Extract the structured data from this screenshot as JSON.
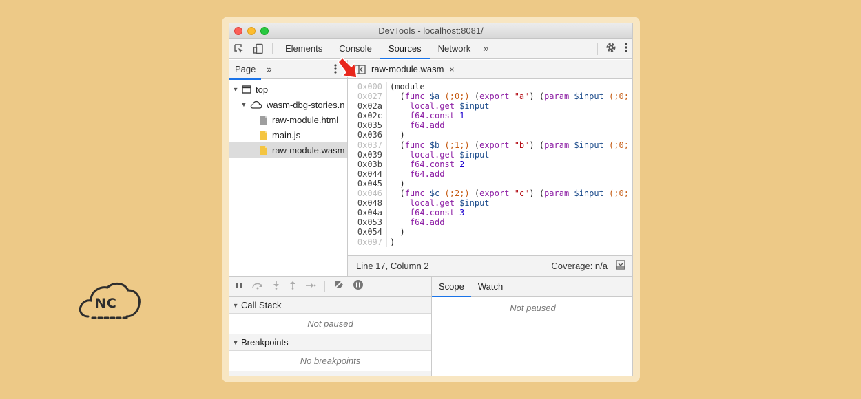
{
  "window": {
    "title": "DevTools - localhost:8081/"
  },
  "main_tabs": [
    {
      "label": "Elements"
    },
    {
      "label": "Console"
    },
    {
      "label": "Sources"
    },
    {
      "label": "Network"
    }
  ],
  "main_tabs_more": "»",
  "navigator": {
    "tab": "Page",
    "more": "»",
    "tree": [
      {
        "label": "top"
      },
      {
        "label": "wasm-dbg-stories.n"
      },
      {
        "label": "raw-module.html"
      },
      {
        "label": "main.js"
      },
      {
        "label": "raw-module.wasm"
      }
    ]
  },
  "editor": {
    "tab_label": "raw-module.wasm",
    "close": "×",
    "lines": [
      {
        "addr": "0x000",
        "parts": [
          [
            "p",
            "(module"
          ]
        ]
      },
      {
        "addr": "0x027",
        "parts": [
          [
            "p",
            "  ("
          ],
          [
            "kw",
            "func"
          ],
          [
            "p",
            " "
          ],
          [
            "var",
            "$a"
          ],
          [
            "p",
            " "
          ],
          [
            "cmt",
            "(;0;)"
          ],
          [
            "p",
            " ("
          ],
          [
            "kw",
            "export"
          ],
          [
            "p",
            " "
          ],
          [
            "str",
            "\"a\""
          ],
          [
            "p",
            ") ("
          ],
          [
            "kw",
            "param"
          ],
          [
            "p",
            " "
          ],
          [
            "var",
            "$input"
          ],
          [
            "p",
            " "
          ],
          [
            "cmt",
            "(;0;"
          ]
        ]
      },
      {
        "addr": "0x02a",
        "parts": [
          [
            "p",
            "    "
          ],
          [
            "kw",
            "local.get"
          ],
          [
            "p",
            " "
          ],
          [
            "var",
            "$input"
          ]
        ]
      },
      {
        "addr": "0x02c",
        "parts": [
          [
            "p",
            "    "
          ],
          [
            "kw",
            "f64.const"
          ],
          [
            "p",
            " "
          ],
          [
            "num",
            "1"
          ]
        ]
      },
      {
        "addr": "0x035",
        "parts": [
          [
            "p",
            "    "
          ],
          [
            "kw",
            "f64.add"
          ]
        ]
      },
      {
        "addr": "0x036",
        "parts": [
          [
            "p",
            "  )"
          ]
        ]
      },
      {
        "addr": "0x037",
        "parts": [
          [
            "p",
            "  ("
          ],
          [
            "kw",
            "func"
          ],
          [
            "p",
            " "
          ],
          [
            "var",
            "$b"
          ],
          [
            "p",
            " "
          ],
          [
            "cmt",
            "(;1;)"
          ],
          [
            "p",
            " ("
          ],
          [
            "kw",
            "export"
          ],
          [
            "p",
            " "
          ],
          [
            "str",
            "\"b\""
          ],
          [
            "p",
            ") ("
          ],
          [
            "kw",
            "param"
          ],
          [
            "p",
            " "
          ],
          [
            "var",
            "$input"
          ],
          [
            "p",
            " "
          ],
          [
            "cmt",
            "(;0;"
          ]
        ]
      },
      {
        "addr": "0x039",
        "parts": [
          [
            "p",
            "    "
          ],
          [
            "kw",
            "local.get"
          ],
          [
            "p",
            " "
          ],
          [
            "var",
            "$input"
          ]
        ]
      },
      {
        "addr": "0x03b",
        "parts": [
          [
            "p",
            "    "
          ],
          [
            "kw",
            "f64.const"
          ],
          [
            "p",
            " "
          ],
          [
            "num",
            "2"
          ]
        ]
      },
      {
        "addr": "0x044",
        "parts": [
          [
            "p",
            "    "
          ],
          [
            "kw",
            "f64.add"
          ]
        ]
      },
      {
        "addr": "0x045",
        "parts": [
          [
            "p",
            "  )"
          ]
        ]
      },
      {
        "addr": "0x046",
        "parts": [
          [
            "p",
            "  ("
          ],
          [
            "kw",
            "func"
          ],
          [
            "p",
            " "
          ],
          [
            "var",
            "$c"
          ],
          [
            "p",
            " "
          ],
          [
            "cmt",
            "(;2;)"
          ],
          [
            "p",
            " ("
          ],
          [
            "kw",
            "export"
          ],
          [
            "p",
            " "
          ],
          [
            "str",
            "\"c\""
          ],
          [
            "p",
            ") ("
          ],
          [
            "kw",
            "param"
          ],
          [
            "p",
            " "
          ],
          [
            "var",
            "$input"
          ],
          [
            "p",
            " "
          ],
          [
            "cmt",
            "(;0;"
          ]
        ]
      },
      {
        "addr": "0x048",
        "parts": [
          [
            "p",
            "    "
          ],
          [
            "kw",
            "local.get"
          ],
          [
            "p",
            " "
          ],
          [
            "var",
            "$input"
          ]
        ]
      },
      {
        "addr": "0x04a",
        "parts": [
          [
            "p",
            "    "
          ],
          [
            "kw",
            "f64.const"
          ],
          [
            "p",
            " "
          ],
          [
            "num",
            "3"
          ]
        ]
      },
      {
        "addr": "0x053",
        "parts": [
          [
            "p",
            "    "
          ],
          [
            "kw",
            "f64.add"
          ]
        ]
      },
      {
        "addr": "0x054",
        "parts": [
          [
            "p",
            "  )"
          ]
        ]
      },
      {
        "addr": "0x097",
        "parts": [
          [
            "p",
            ")"
          ]
        ]
      }
    ],
    "dim_addrs": [
      "0x000",
      "0x027",
      "0x037",
      "0x046",
      "0x097"
    ],
    "status_position": "Line 17, Column 2",
    "status_coverage": "Coverage: n/a"
  },
  "debugger": {
    "call_stack": {
      "title": "Call Stack",
      "empty": "Not paused"
    },
    "breakpoints": {
      "title": "Breakpoints",
      "empty": "No breakpoints"
    },
    "scope_tab": "Scope",
    "watch_tab": "Watch",
    "scope_empty": "Not paused"
  },
  "logo": {
    "text": "NC"
  },
  "colors": {
    "accent": "#1a73e8",
    "arrow": "#e8261b",
    "background": "#edc987"
  }
}
